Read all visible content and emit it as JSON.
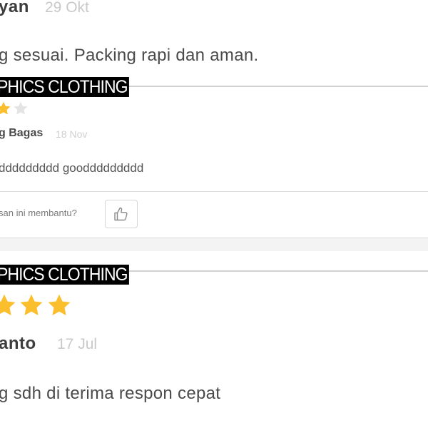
{
  "reviews": [
    {
      "reviewer": "yan",
      "date": "29 Okt",
      "text": "g sesuai. Packing rapi dan aman."
    },
    {
      "product": "PHICS CLOTHING",
      "rating": 4,
      "reviewer": "g Bagas",
      "date": "18 Nov",
      "text": "ddddddddd gooddddddddd",
      "helpful_prompt": "san ini membantu?"
    },
    {
      "product": "PHICS CLOTHING",
      "rating": 5,
      "reviewer": "anto",
      "date": "17 Jul",
      "text": "g sdh di terima respon cepat"
    }
  ],
  "colors": {
    "star_filled": "#FBBF2D",
    "star_empty": "#E4E4E4",
    "product_label_bg": "#000000",
    "product_label_text": "#FFFFFF"
  },
  "icons": {
    "like_button": "thumbs-up-icon",
    "star": "star-icon"
  }
}
